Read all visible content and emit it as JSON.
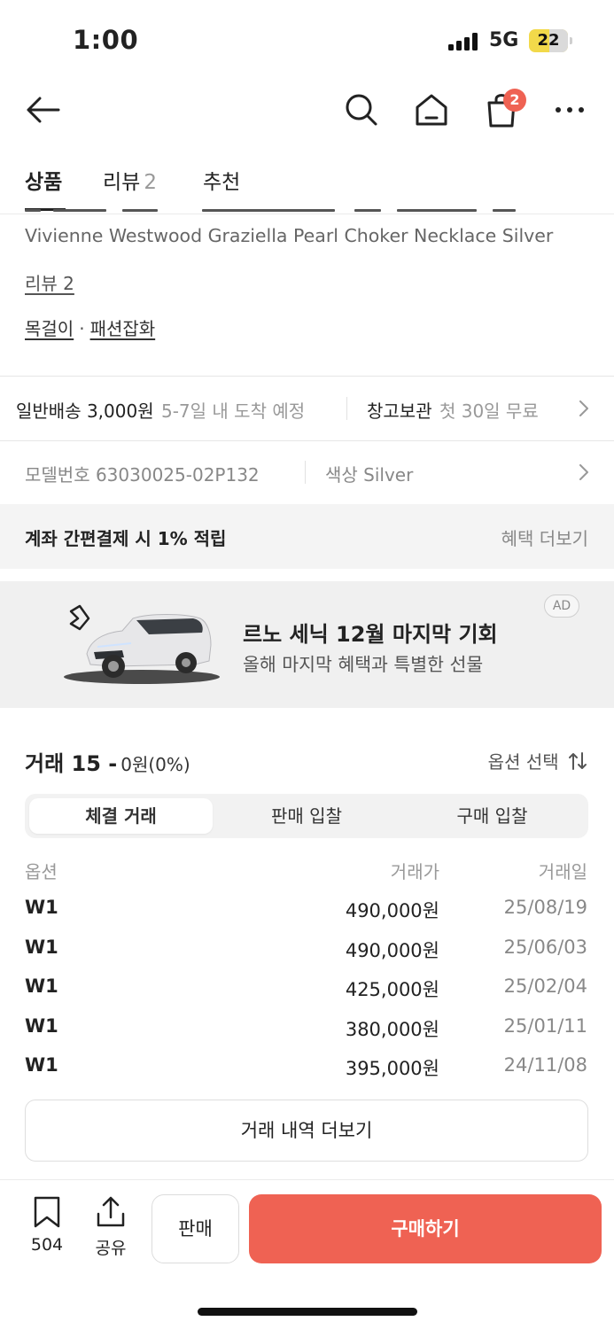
{
  "status_bar": {
    "time": "1:00",
    "network": "5G",
    "battery": "22"
  },
  "top_nav": {
    "cart_count": "2"
  },
  "tabs": [
    {
      "label": "상품",
      "count": ""
    },
    {
      "label": "리뷰",
      "count": "2"
    },
    {
      "label": "추천",
      "count": ""
    }
  ],
  "product": {
    "name": "Vivienne Westwood Graziella Pearl Choker Necklace Silver",
    "review_link": "리뷰 2",
    "category_1": "목걸이",
    "category_sep": "·",
    "category_2": "패션잡화"
  },
  "shipping": {
    "label": "일반배송 3,000원",
    "eta": "5-7일 내 도착 예정",
    "storage_label": "창고보관",
    "storage_note": "첫 30일 무료"
  },
  "model": {
    "number": "모델번호 63030025-02P132",
    "color": "색상 Silver"
  },
  "benefit": {
    "text": "계좌 간편결제 시 1% 적립",
    "more": "혜택 더보기"
  },
  "ad": {
    "title": "르노 세닉 12월 마지막 기회",
    "subtitle": "올해 마지막 혜택과 특별한 선물",
    "badge": "AD"
  },
  "trades": {
    "title": "거래 15 -",
    "change": "0원(0%)",
    "option_select": "옵션 선택",
    "segments": [
      "체결 거래",
      "판매 입찰",
      "구매 입찰"
    ],
    "active_segment": 0,
    "columns": {
      "option": "옵션",
      "price": "거래가",
      "date": "거래일"
    },
    "rows": [
      {
        "option": "W1",
        "price": "490,000원",
        "date": "25/08/19"
      },
      {
        "option": "W1",
        "price": "490,000원",
        "date": "25/06/03"
      },
      {
        "option": "W1",
        "price": "425,000원",
        "date": "25/02/04"
      },
      {
        "option": "W1",
        "price": "380,000원",
        "date": "25/01/11"
      },
      {
        "option": "W1",
        "price": "395,000원",
        "date": "24/11/08"
      }
    ],
    "more_button": "거래 내역 더보기"
  },
  "bottom_bar": {
    "bookmark_count": "504",
    "share_label": "공유",
    "sell_label": "판매",
    "buy_label": "구매하기"
  },
  "colors": {
    "accent": "#ef6253",
    "muted_text": "#888888",
    "panel_bg": "#f4f4f4"
  }
}
